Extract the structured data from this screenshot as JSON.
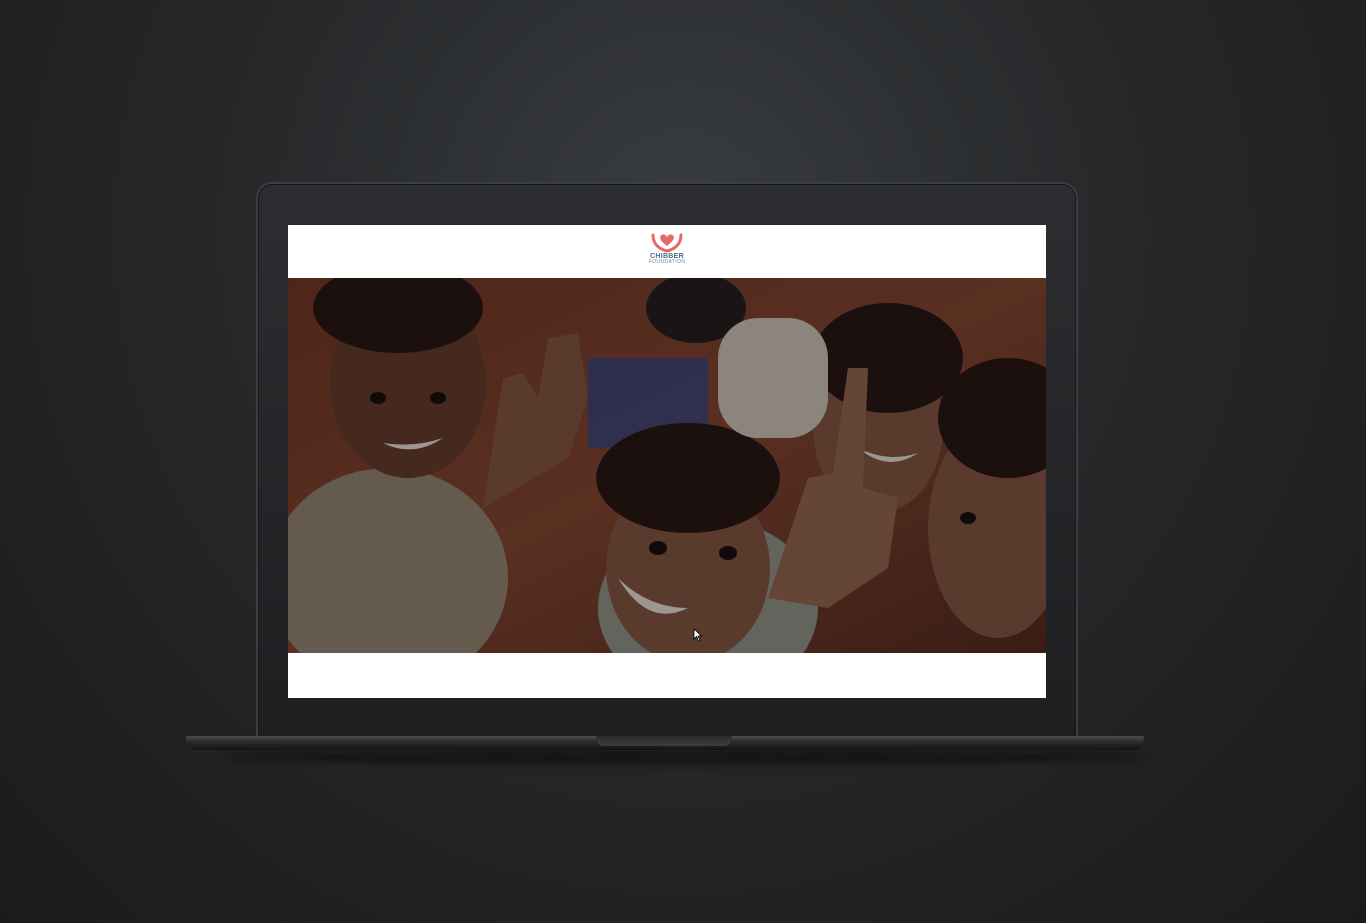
{
  "site": {
    "logo_name": "CHIBBER",
    "logo_sub": "FOUNDATION",
    "brand_color": "#e46a6a",
    "text_color": "#4a6a80"
  },
  "hero": {
    "image_description": "photo",
    "overlay_color": "#000000"
  },
  "icons": {
    "logo_mark": "heart-hands-icon",
    "cursor": "mouse-pointer-icon"
  }
}
